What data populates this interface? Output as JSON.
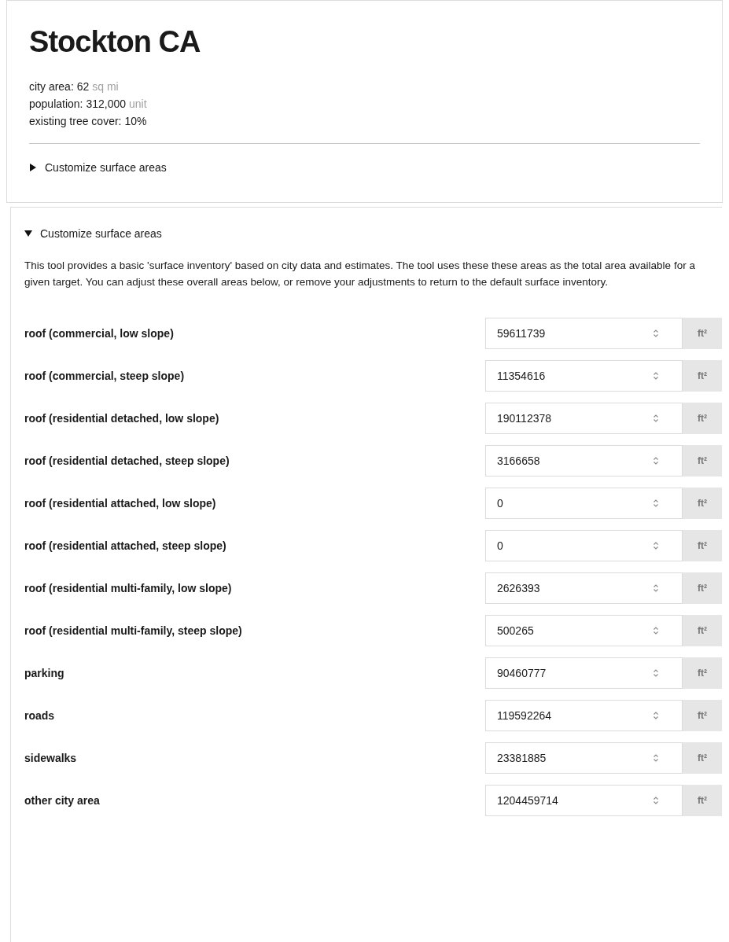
{
  "title": "Stockton CA",
  "stats": [
    {
      "label": "city area:",
      "value": "62",
      "unit": "sq mi"
    },
    {
      "label": "population:",
      "value": "312,000",
      "unit": "unit"
    },
    {
      "label": "existing tree cover:",
      "value": "10%"
    }
  ],
  "summary": {
    "label": "Customize surface areas",
    "expanded": false
  },
  "panel": {
    "summary": {
      "label": "Customize surface areas",
      "expanded": true
    },
    "description": "This tool provides a basic 'surface inventory' based on city data and estimates. The tool uses these these areas as the total area available for a given target. You can adjust these overall areas below, or remove your adjustments to return to the default surface inventory.",
    "rows": [
      {
        "label": "roof (commercial, low slope)",
        "value": "59611739",
        "unit": "ft²"
      },
      {
        "label": "roof (commercial, steep slope)",
        "value": "11354616",
        "unit": "ft²"
      },
      {
        "label": "roof (residential detached, low slope)",
        "value": "190112378",
        "unit": "ft²"
      },
      {
        "label": "roof (residential detached, steep slope)",
        "value": "3166658",
        "unit": "ft²"
      },
      {
        "label": "roof (residential attached, low slope)",
        "value": "0",
        "unit": "ft²"
      },
      {
        "label": "roof (residential attached, steep slope)",
        "value": "0",
        "unit": "ft²"
      },
      {
        "label": "roof (residential multi-family, low slope)",
        "value": "2626393",
        "unit": "ft²"
      },
      {
        "label": "roof (residential multi-family, steep slope)",
        "value": "500265",
        "unit": "ft²"
      },
      {
        "label": "parking",
        "value": "90460777",
        "unit": "ft²"
      },
      {
        "label": "roads",
        "value": "119592264",
        "unit": "ft²"
      },
      {
        "label": "sidewalks",
        "value": "23381885",
        "unit": "ft²"
      },
      {
        "label": "other city area",
        "value": "1204459714",
        "unit": "ft²"
      }
    ]
  }
}
